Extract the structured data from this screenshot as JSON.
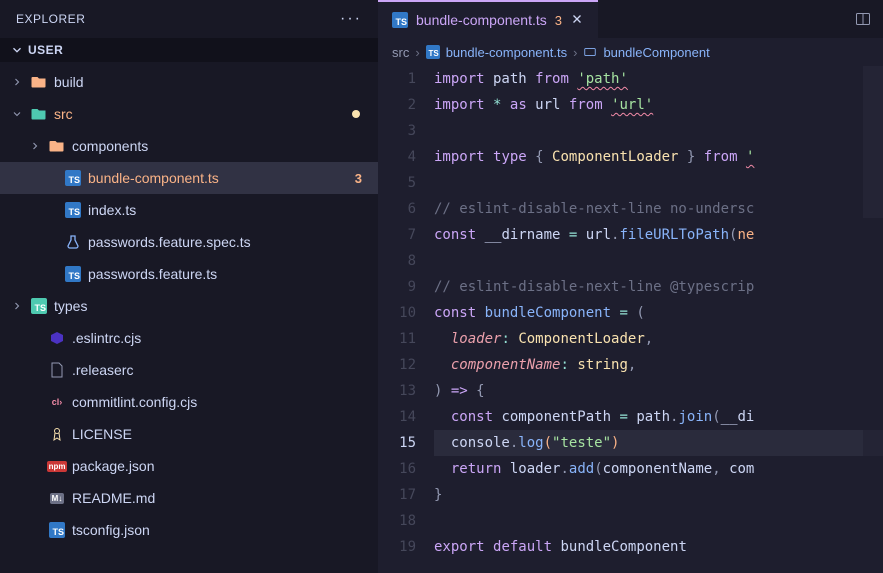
{
  "sidebar": {
    "title": "EXPLORER",
    "section": "USER",
    "items": [
      {
        "label": "build",
        "icon": "folder",
        "indent": 1,
        "chevron": "right"
      },
      {
        "label": "src",
        "icon": "folder-src",
        "indent": 1,
        "chevron": "down",
        "modified": true,
        "highlight": true
      },
      {
        "label": "components",
        "icon": "folder",
        "indent": 2,
        "chevron": "right"
      },
      {
        "label": "bundle-component.ts",
        "icon": "ts",
        "indent": 3,
        "active": true,
        "badge": "3",
        "highlight": true
      },
      {
        "label": "index.ts",
        "icon": "ts",
        "indent": 3
      },
      {
        "label": "passwords.feature.spec.ts",
        "icon": "test",
        "indent": 3
      },
      {
        "label": "passwords.feature.ts",
        "icon": "ts",
        "indent": 3
      },
      {
        "label": "types",
        "icon": "folder-ts",
        "indent": 1,
        "chevron": "right"
      },
      {
        "label": ".eslintrc.cjs",
        "icon": "eslint",
        "indent": 2
      },
      {
        "label": ".releaserc",
        "icon": "file",
        "indent": 2
      },
      {
        "label": "commitlint.config.cjs",
        "icon": "commitlint",
        "indent": 2
      },
      {
        "label": "LICENSE",
        "icon": "license",
        "indent": 2
      },
      {
        "label": "package.json",
        "icon": "npm",
        "indent": 2
      },
      {
        "label": "README.md",
        "icon": "md",
        "indent": 2
      },
      {
        "label": "tsconfig.json",
        "icon": "tsconfig",
        "indent": 2
      }
    ]
  },
  "tab": {
    "icon": "TS",
    "label": "bundle-component.ts",
    "badge": "3"
  },
  "breadcrumb": {
    "parts": [
      "src",
      "bundle-component.ts",
      "bundleComponent"
    ]
  },
  "code": {
    "lines": [
      {
        "n": 1,
        "tokens": [
          [
            "kw",
            "import"
          ],
          [
            "var",
            " path "
          ],
          [
            "kw",
            "from"
          ],
          [
            "var",
            " "
          ],
          [
            "str",
            "'path'",
            "squiggle"
          ]
        ]
      },
      {
        "n": 2,
        "tokens": [
          [
            "kw",
            "import"
          ],
          [
            "var",
            " "
          ],
          [
            "op",
            "*"
          ],
          [
            "var",
            " "
          ],
          [
            "kw",
            "as"
          ],
          [
            "var",
            " url "
          ],
          [
            "kw",
            "from"
          ],
          [
            "var",
            " "
          ],
          [
            "str",
            "'url'",
            "squiggle"
          ]
        ]
      },
      {
        "n": 3,
        "tokens": []
      },
      {
        "n": 4,
        "tokens": [
          [
            "kw",
            "import"
          ],
          [
            "var",
            " "
          ],
          [
            "kw",
            "type"
          ],
          [
            "var",
            " "
          ],
          [
            "punc",
            "{"
          ],
          [
            "var",
            " "
          ],
          [
            "type",
            "ComponentLoader"
          ],
          [
            "var",
            " "
          ],
          [
            "punc",
            "}"
          ],
          [
            "var",
            " "
          ],
          [
            "kw",
            "from"
          ],
          [
            "var",
            " "
          ],
          [
            "str",
            "'",
            "squiggle"
          ]
        ]
      },
      {
        "n": 5,
        "tokens": []
      },
      {
        "n": 6,
        "tokens": [
          [
            "com",
            "// eslint-disable-next-line no-undersc"
          ]
        ]
      },
      {
        "n": 7,
        "tokens": [
          [
            "kw",
            "const"
          ],
          [
            "var",
            " __dirname "
          ],
          [
            "op",
            "="
          ],
          [
            "var",
            " url"
          ],
          [
            "punc",
            "."
          ],
          [
            "fn",
            "fileURLToPath"
          ],
          [
            "punc",
            "("
          ],
          [
            "orange",
            "ne"
          ]
        ]
      },
      {
        "n": 8,
        "tokens": []
      },
      {
        "n": 9,
        "tokens": [
          [
            "com",
            "// eslint-disable-next-line @typescrip"
          ]
        ]
      },
      {
        "n": 10,
        "tokens": [
          [
            "kw",
            "const"
          ],
          [
            "var",
            " "
          ],
          [
            "fn",
            "bundleComponent"
          ],
          [
            "var",
            " "
          ],
          [
            "op",
            "="
          ],
          [
            "var",
            " "
          ],
          [
            "punc",
            "("
          ]
        ]
      },
      {
        "n": 11,
        "tokens": [
          [
            "var",
            "  "
          ],
          [
            "param",
            "loader"
          ],
          [
            "op",
            ":"
          ],
          [
            "var",
            " "
          ],
          [
            "type",
            "ComponentLoader"
          ],
          [
            "punc",
            ","
          ]
        ]
      },
      {
        "n": 12,
        "tokens": [
          [
            "var",
            "  "
          ],
          [
            "param",
            "componentName"
          ],
          [
            "op",
            ":"
          ],
          [
            "var",
            " "
          ],
          [
            "type",
            "string"
          ],
          [
            "punc",
            ","
          ]
        ]
      },
      {
        "n": 13,
        "tokens": [
          [
            "punc",
            ")"
          ],
          [
            "var",
            " "
          ],
          [
            "kw",
            "=>"
          ],
          [
            "var",
            " "
          ],
          [
            "punc",
            "{"
          ]
        ]
      },
      {
        "n": 14,
        "tokens": [
          [
            "var",
            "  "
          ],
          [
            "kw",
            "const"
          ],
          [
            "var",
            " componentPath "
          ],
          [
            "op",
            "="
          ],
          [
            "var",
            " path"
          ],
          [
            "punc",
            "."
          ],
          [
            "fn",
            "join"
          ],
          [
            "punc",
            "("
          ],
          [
            "var",
            "__di"
          ]
        ],
        "bulb": true
      },
      {
        "n": 15,
        "tokens": [
          [
            "var",
            "  console"
          ],
          [
            "punc",
            "."
          ],
          [
            "fn",
            "log"
          ],
          [
            "orange",
            "("
          ],
          [
            "str",
            "\"teste\""
          ],
          [
            "orange",
            ")"
          ]
        ],
        "current": true
      },
      {
        "n": 16,
        "tokens": [
          [
            "var",
            "  "
          ],
          [
            "kw",
            "return"
          ],
          [
            "var",
            " loader"
          ],
          [
            "punc",
            "."
          ],
          [
            "fn",
            "add"
          ],
          [
            "punc",
            "("
          ],
          [
            "var",
            "componentName"
          ],
          [
            "punc",
            ","
          ],
          [
            "var",
            " com"
          ]
        ]
      },
      {
        "n": 17,
        "tokens": [
          [
            "punc",
            "}"
          ]
        ]
      },
      {
        "n": 18,
        "tokens": []
      },
      {
        "n": 19,
        "tokens": [
          [
            "kw",
            "export"
          ],
          [
            "var",
            " "
          ],
          [
            "kw",
            "default"
          ],
          [
            "var",
            " bundleComponent"
          ]
        ]
      }
    ]
  }
}
